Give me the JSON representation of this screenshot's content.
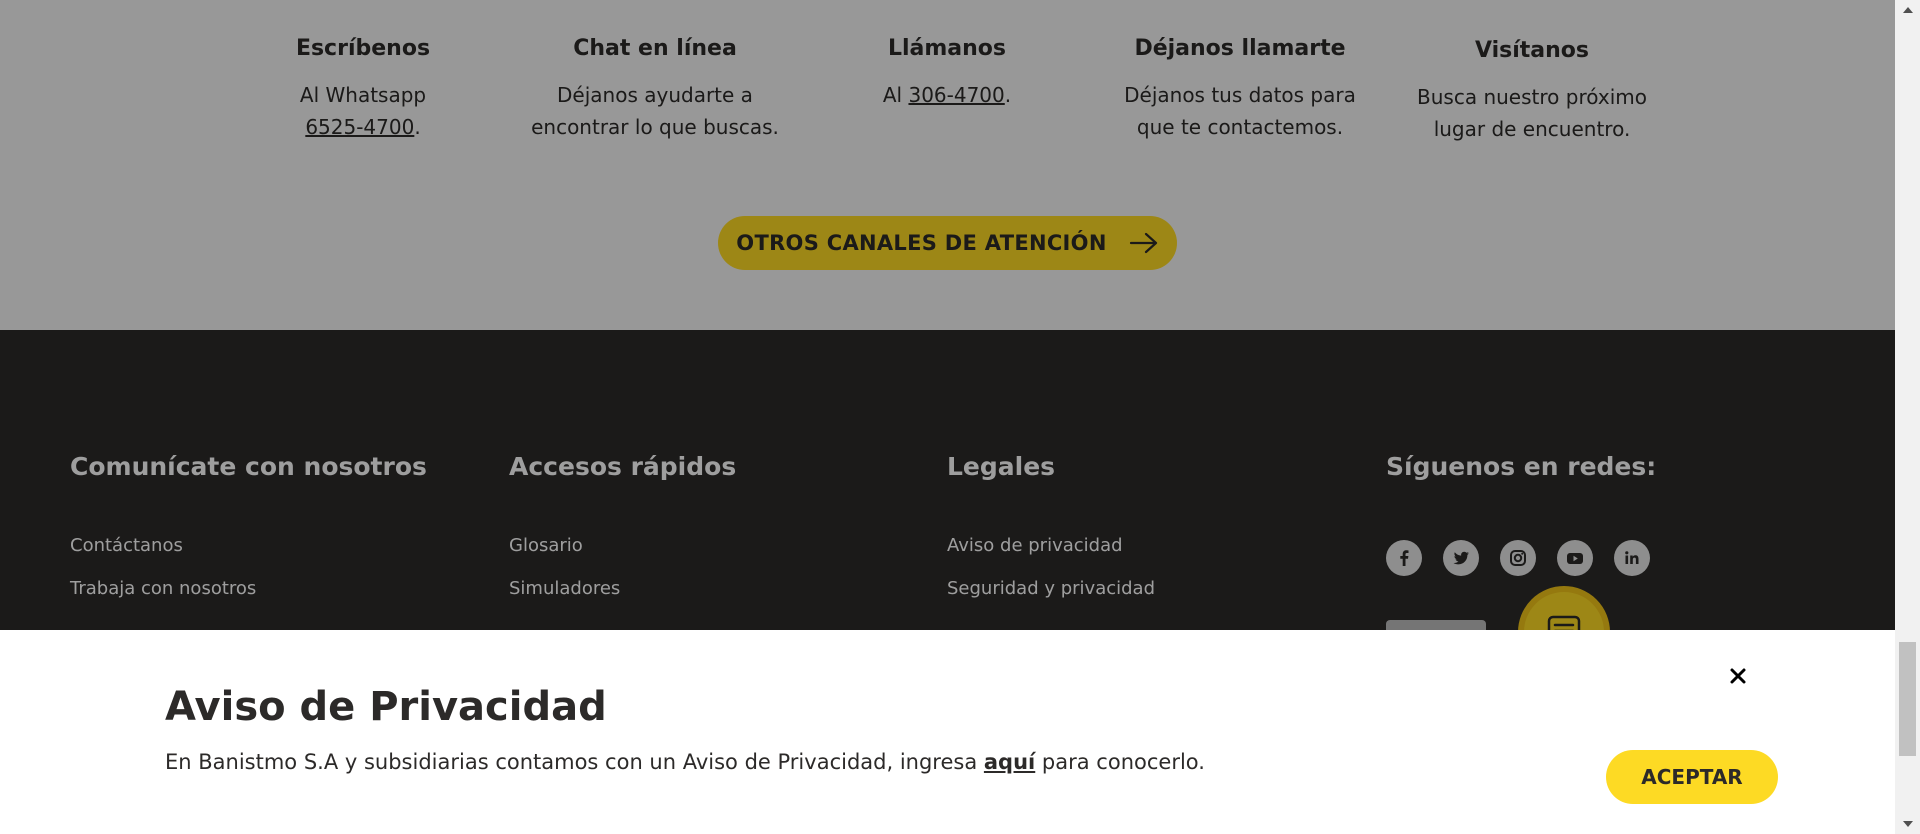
{
  "channels": [
    {
      "title": "Escríbenos",
      "line1": "Al Whatsapp",
      "link": "6525-4700",
      "suffix": "."
    },
    {
      "title": "Chat en línea",
      "line1": "Déjanos ayudarte a",
      "line2": "encontrar lo que buscas."
    },
    {
      "title": "Llámanos",
      "prefix": "Al ",
      "link": "306-4700",
      "suffix": "."
    },
    {
      "title": "Déjanos llamarte",
      "line1": "Déjanos tus datos para",
      "line2": "que te contactemos."
    },
    {
      "title": "Visítanos",
      "line1": "Busca nuestro próximo",
      "line2": "lugar de encuentro."
    }
  ],
  "cta": {
    "label": "OTROS CANALES DE ATENCIÓN"
  },
  "footer": {
    "columns": [
      {
        "heading": "Comunícate con nosotros",
        "links": [
          "Contáctanos",
          "Trabaja con nosotros"
        ]
      },
      {
        "heading": "Accesos rápidos",
        "links": [
          "Glosario",
          "Simuladores"
        ]
      },
      {
        "heading": "Legales",
        "links": [
          "Aviso de privacidad",
          "Seguridad y privacidad"
        ]
      },
      {
        "heading": "Síguenos en redes:"
      }
    ],
    "social_icons": [
      "facebook-icon",
      "twitter-icon",
      "instagram-icon",
      "youtube-icon",
      "linkedin-icon"
    ]
  },
  "privacy": {
    "title": "Aviso de Privacidad",
    "text_before": "En Banistmo S.A y subsidiarias contamos con un Aviso de Privacidad, ingresa ",
    "link": "aquí",
    "text_after": " para conocerlo.",
    "accept_label": "ACEPTAR",
    "close_icon": "close-icon"
  },
  "colors": {
    "brand_yellow": "#fdda24",
    "footer_bg": "#2c2a29",
    "text_dark": "#2c2a29"
  }
}
